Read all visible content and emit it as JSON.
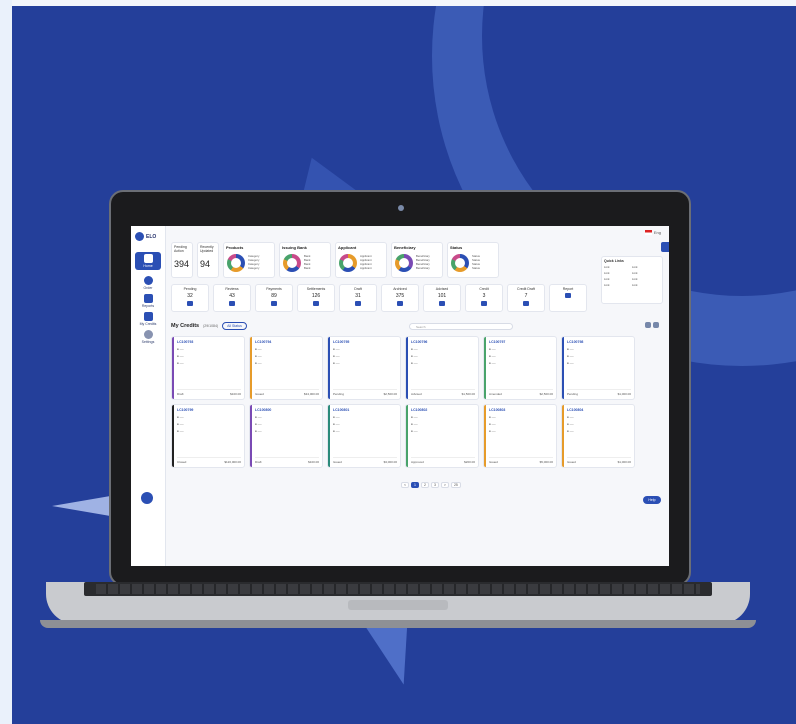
{
  "app": {
    "logo": "ELO",
    "lang": "Eng"
  },
  "nav": [
    {
      "label": "Home",
      "active": true
    },
    {
      "label": "Order",
      "active": false
    },
    {
      "label": "Reports",
      "active": false
    },
    {
      "label": "My Credits",
      "active": false
    },
    {
      "label": "Settings",
      "active": false
    }
  ],
  "stats": [
    {
      "title": "Pending Action",
      "value": "394"
    },
    {
      "title": "Recently Updated",
      "value": "94"
    }
  ],
  "donuts": [
    {
      "title": "Products",
      "colors": [
        "#2b4fb4",
        "#e69b2a",
        "#49a36b",
        "#c84a8a"
      ],
      "legend": [
        "Category",
        "Category",
        "Category",
        "Category"
      ]
    },
    {
      "title": "Issuing Bank",
      "colors": [
        "#c84a8a",
        "#2b4fb4",
        "#e69b2a",
        "#49a36b"
      ],
      "legend": [
        "Bank",
        "Bank",
        "Bank",
        "Bank"
      ]
    },
    {
      "title": "Applicant",
      "colors": [
        "#e69b2a",
        "#2b4fb4",
        "#49a36b",
        "#c84a8a"
      ],
      "legend": [
        "Applicant",
        "Applicant",
        "Applicant",
        "Applicant"
      ]
    },
    {
      "title": "Beneficiary",
      "colors": [
        "#7a4ab4",
        "#2b4fb4",
        "#e69b2a",
        "#49a36b"
      ],
      "legend": [
        "Beneficiary",
        "Beneficiary",
        "Beneficiary",
        "Beneficiary"
      ]
    },
    {
      "title": "Status",
      "colors": [
        "#2b4fb4",
        "#e69b2a",
        "#49a36b",
        "#c84a8a"
      ],
      "legend": [
        "Status",
        "Status",
        "Status",
        "Status"
      ]
    }
  ],
  "filters": {
    "title": "Quick Links",
    "items": [
      "Link",
      "Link",
      "Link",
      "Link",
      "Link",
      "Link",
      "Link",
      "Link"
    ]
  },
  "minis": [
    {
      "title": "Pending",
      "value": "32"
    },
    {
      "title": "Reviews",
      "value": "43"
    },
    {
      "title": "Payments",
      "value": "89"
    },
    {
      "title": "Settlements",
      "value": "126"
    },
    {
      "title": "Draft",
      "value": "31"
    },
    {
      "title": "Archived",
      "value": "375"
    },
    {
      "title": "Advised",
      "value": "101"
    },
    {
      "title": "Credit",
      "value": "3"
    },
    {
      "title": "Credit Draft",
      "value": "7"
    },
    {
      "title": "Report",
      "value": ""
    }
  ],
  "credits": {
    "heading": "My Credits",
    "count": "(29/1084)",
    "filter": "All Status",
    "search_placeholder": "Search"
  },
  "cards": [
    {
      "id": "LC100793",
      "color": "#7a4ab4",
      "status": "Draft",
      "amount": "$100.00"
    },
    {
      "id": "LC100794",
      "color": "#e69b2a",
      "status": "Issued",
      "amount": "$34,000.00"
    },
    {
      "id": "LC100795",
      "color": "#2b4fb4",
      "status": "Pending",
      "amount": "$2,500.00"
    },
    {
      "id": "LC100796",
      "color": "#2b4fb4",
      "status": "Advised",
      "amount": "$1,500.00"
    },
    {
      "id": "LC100797",
      "color": "#49a36b",
      "status": "Amended",
      "amount": "$2,500.00"
    },
    {
      "id": "LC100798",
      "color": "#2b4fb4",
      "status": "Pending",
      "amount": "$1,000.00"
    },
    {
      "id": "LC100799",
      "color": "#222222",
      "status": "Closed",
      "amount": "$120,000.00"
    },
    {
      "id": "LC100800",
      "color": "#7a4ab4",
      "status": "Draft",
      "amount": "$100.00"
    },
    {
      "id": "LC100801",
      "color": "#2b8a7a",
      "status": "Issued",
      "amount": "$3,000.00"
    },
    {
      "id": "LC100802",
      "color": "#49a36b",
      "status": "Approved",
      "amount": "$200.00"
    },
    {
      "id": "LC100803",
      "color": "#e69b2a",
      "status": "Issued",
      "amount": "$5,000.00"
    },
    {
      "id": "LC100804",
      "color": "#e69b2a",
      "status": "Issued",
      "amount": "$1,000.00"
    }
  ],
  "pager": [
    "<",
    "1",
    "2",
    "3",
    ">",
    "25"
  ],
  "help": "Help"
}
